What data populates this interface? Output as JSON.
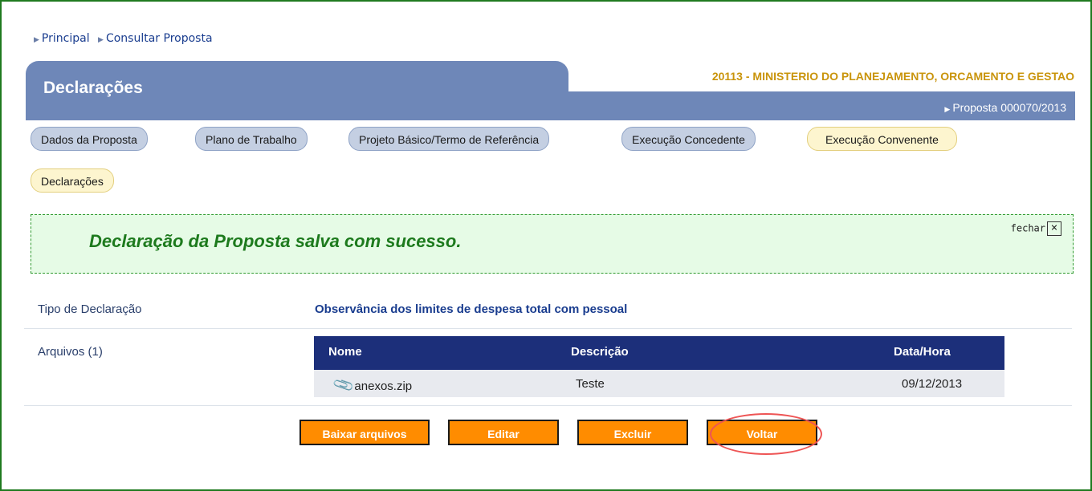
{
  "breadcrumb": [
    "Principal",
    "Consultar Proposta"
  ],
  "header": {
    "title": "Declarações",
    "org": "20113 - MINISTERIO DO PLANEJAMENTO, ORCAMENTO E GESTAO",
    "proposta": "Proposta 000070/2013"
  },
  "tabs": [
    {
      "label": "Dados da Proposta"
    },
    {
      "label": "Plano de Trabalho"
    },
    {
      "label": "Projeto Básico/Termo de Referência"
    },
    {
      "label": "Execução Concedente"
    },
    {
      "label": "Execução Convenente"
    },
    {
      "label": "Declarações"
    }
  ],
  "message": {
    "text": "Declaração da Proposta salva com sucesso.",
    "close_label": "fechar",
    "close_icon": "☒"
  },
  "fields": {
    "tipo_label": "Tipo de Declaração",
    "tipo_value": "Observância dos limites de despesa total com pessoal",
    "arquivos_label": "Arquivos (1)"
  },
  "table": {
    "headers": [
      "Nome",
      "Descrição",
      "Data/Hora"
    ],
    "rows": [
      {
        "nome": "anexos.zip",
        "descricao": "Teste",
        "data": "09/12/2013"
      }
    ]
  },
  "buttons": {
    "baixar": "Baixar arquivos",
    "editar": "Editar",
    "excluir": "Excluir",
    "voltar": "Voltar"
  },
  "colors": {
    "accent": "#ff8c00",
    "header": "#6e87b8",
    "table_header": "#1c2f7a",
    "success": "#1d7a1d"
  }
}
